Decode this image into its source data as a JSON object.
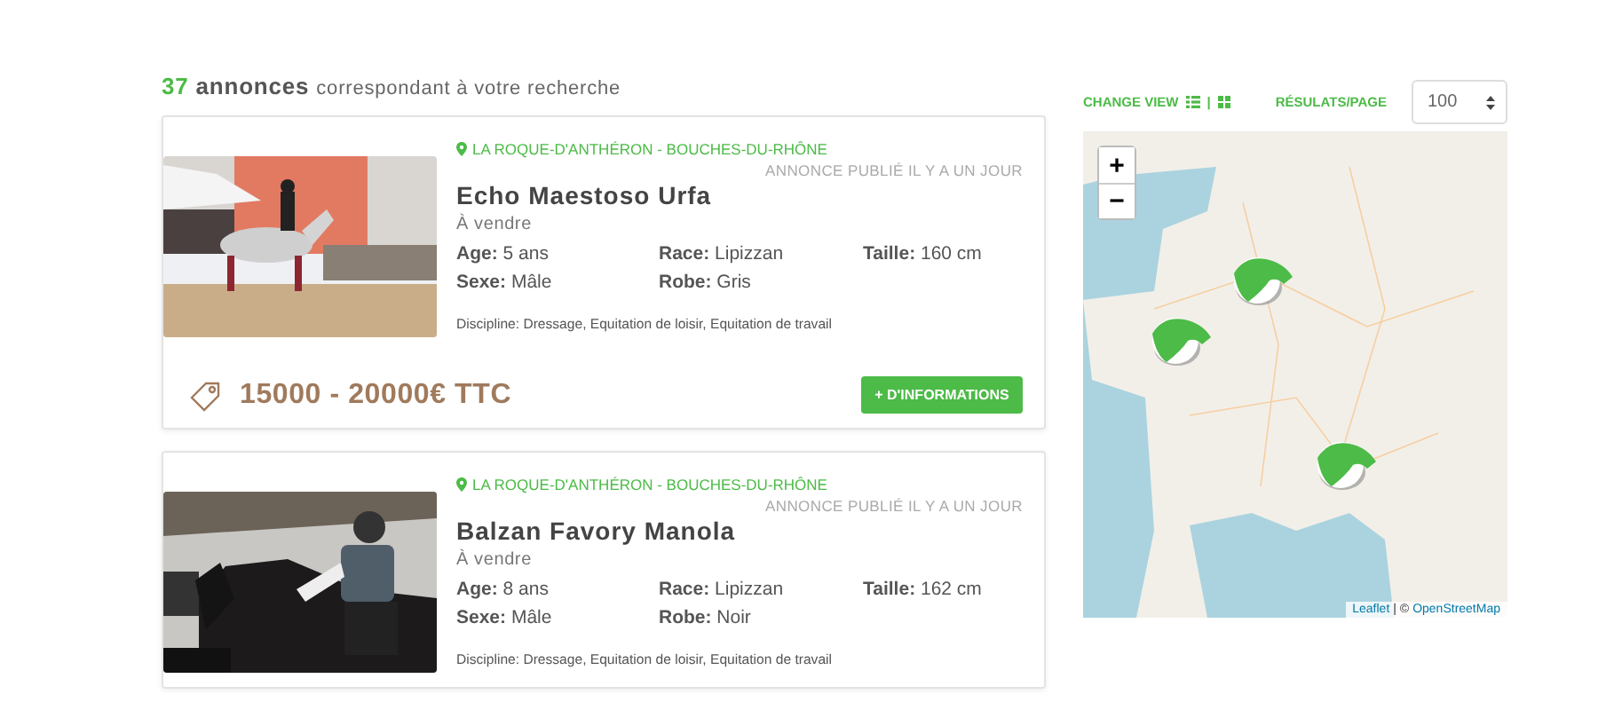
{
  "results_header": {
    "count": "37",
    "count_label": "annonces",
    "rest": "correspondant à votre recherche"
  },
  "toolbar": {
    "change_view": "CHANGE VIEW",
    "separator": "|",
    "per_page_label": "RÉSULATS/PAGE",
    "per_page_value": "100"
  },
  "listings": [
    {
      "location": "LA ROQUE-D'ANTHÉRON - BOUCHES-DU-RHÔNE",
      "published": "ANNONCE PUBLIÉ IL Y A UN JOUR",
      "name": "Echo Maestoso Urfa",
      "status": "À vendre",
      "specs": [
        {
          "label": "Age:",
          "value": "5 ans"
        },
        {
          "label": "Race:",
          "value": "Lipizzan"
        },
        {
          "label": "Taille:",
          "value": "160 cm"
        },
        {
          "label": "Sexe:",
          "value": "Mâle"
        },
        {
          "label": "Robe:",
          "value": "Gris"
        }
      ],
      "discipline": "Discipline: Dressage, Equitation de loisir, Equitation de travail",
      "price": "15000 - 20000€ TTC",
      "button": "+ D'INFORMATIONS"
    },
    {
      "location": "LA ROQUE-D'ANTHÉRON - BOUCHES-DU-RHÔNE",
      "published": "ANNONCE PUBLIÉ IL Y A UN JOUR",
      "name": "Balzan Favory Manola",
      "status": "À vendre",
      "specs": [
        {
          "label": "Age:",
          "value": "8 ans"
        },
        {
          "label": "Race:",
          "value": "Lipizzan"
        },
        {
          "label": "Taille:",
          "value": "162 cm"
        },
        {
          "label": "Sexe:",
          "value": "Mâle"
        },
        {
          "label": "Robe:",
          "value": "Noir"
        }
      ],
      "discipline": "Discipline: Dressage, Equitation de loisir, Equitation de travail"
    }
  ],
  "map": {
    "zoom_in": "+",
    "zoom_out": "−",
    "attribution_link": "Leaflet",
    "attribution_sep": "| ©",
    "attribution_source": "OpenStreetMap"
  }
}
